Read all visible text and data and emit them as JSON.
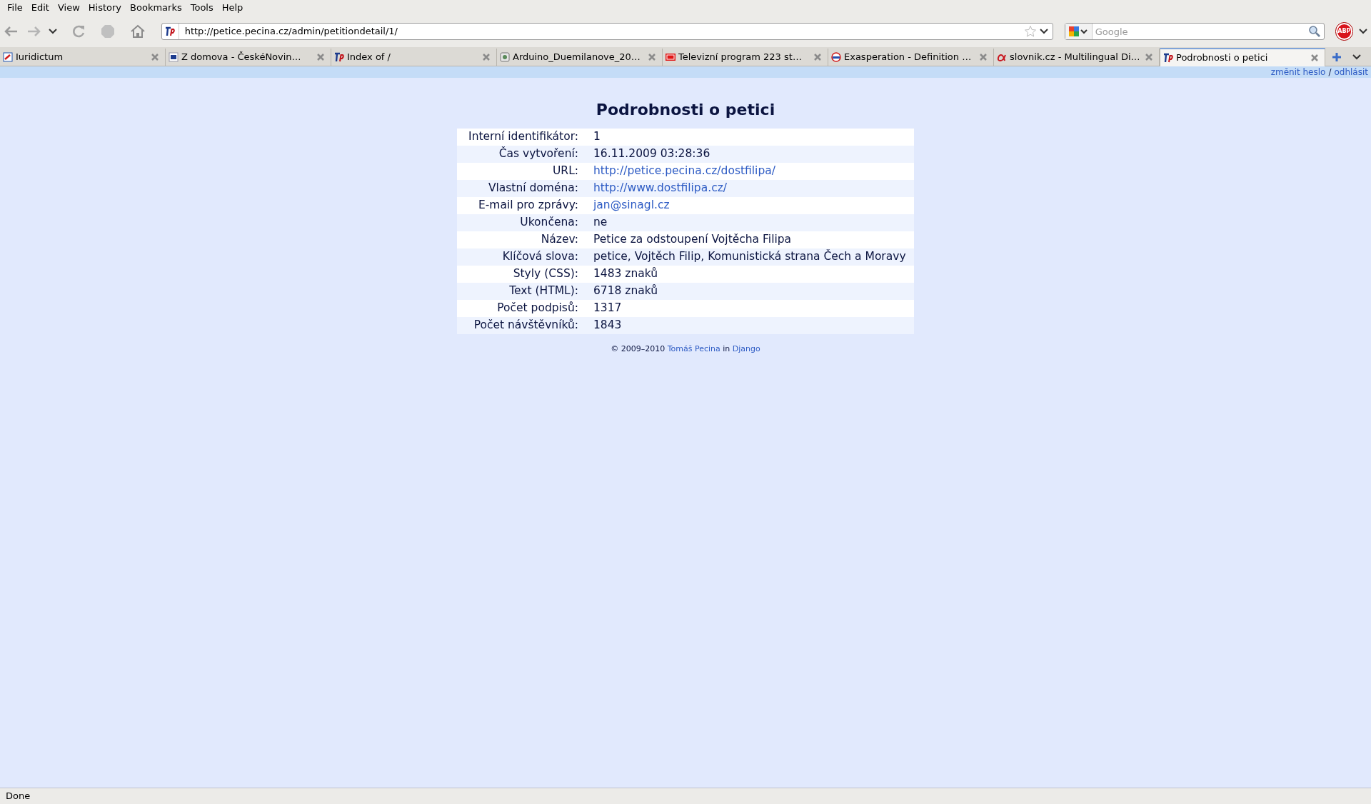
{
  "menu": [
    "File",
    "Edit",
    "View",
    "History",
    "Bookmarks",
    "Tools",
    "Help"
  ],
  "address_bar": {
    "value": "http://petice.pecina.cz/admin/petitiondetail/1/"
  },
  "search": {
    "placeholder": "Google"
  },
  "adblock": "ABP",
  "tabs": [
    {
      "label": "Iuridictum",
      "selected": false
    },
    {
      "label": "Z domova - ČeskéNovin…",
      "selected": false
    },
    {
      "label": "Index of /",
      "selected": false
    },
    {
      "label": "Arduino_Duemilanove_20…",
      "selected": false
    },
    {
      "label": "Televizní program 223 st…",
      "selected": false
    },
    {
      "label": "Exasperation - Definition …",
      "selected": false
    },
    {
      "label": "slovnik.cz - Multilingual Di…",
      "selected": false
    },
    {
      "label": "Podrobnosti o petici",
      "selected": true
    }
  ],
  "user_links": [
    "změnit heslo",
    "odhlásit"
  ],
  "user_links_separator": "/",
  "page": {
    "title": "Podrobnosti o petici",
    "rows": [
      {
        "label": "Interní identifikátor:",
        "value": "1",
        "kind": "text"
      },
      {
        "label": "Čas vytvoření:",
        "value": "16.11.2009 03:28:36",
        "kind": "text"
      },
      {
        "label": "URL:",
        "value": "http://petice.pecina.cz/dostfilipa/",
        "kind": "link"
      },
      {
        "label": "Vlastní doména:",
        "value": "http://www.dostfilipa.cz/",
        "kind": "link"
      },
      {
        "label": "E-mail pro zprávy:",
        "value": "jan@sinagl.cz",
        "kind": "link"
      },
      {
        "label": "Ukončena:",
        "value": "ne",
        "kind": "text"
      },
      {
        "label": "Název:",
        "value": "Petice za odstoupení Vojtěcha Filipa",
        "kind": "text"
      },
      {
        "label": "Klíčová slova:",
        "value": "petice, Vojtěch Filip, Komunistická strana Čech a Moravy",
        "kind": "text"
      },
      {
        "label": "Styly (CSS):",
        "value": "1483 znaků",
        "kind": "text"
      },
      {
        "label": "Text (HTML):",
        "value": "6718 znaků",
        "kind": "text"
      },
      {
        "label": "Počet podpisů:",
        "value": "1317",
        "kind": "text"
      },
      {
        "label": "Počet návštěvníků:",
        "value": "1843",
        "kind": "text"
      }
    ],
    "footer": {
      "copyright": "© 2009–2010",
      "author": "Tomáš Pecina",
      "joiner": "in",
      "framework": "Django"
    }
  },
  "status_bar": "Done"
}
